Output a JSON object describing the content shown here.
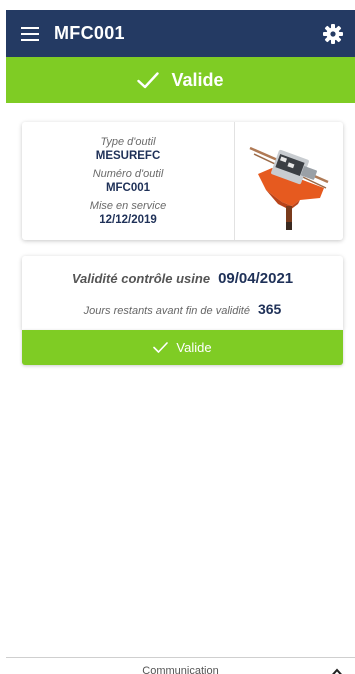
{
  "header": {
    "title": "MFC001",
    "menu_icon": "hamburger-menu-icon",
    "settings_icon": "gear-icon"
  },
  "status_banner": {
    "label": "Valide",
    "icon": "check-icon",
    "color": "#7fcc24"
  },
  "tool": {
    "type_label": "Type d'outil",
    "type_value": "MESUREFC",
    "number_label": "Numéro d'outil",
    "number_value": "MFC001",
    "service_label": "Mise en service",
    "service_value": "12/12/2019"
  },
  "validity": {
    "label": "Validité contrôle usine",
    "date": "09/04/2021",
    "remaining_label": "Jours restants avant fin de validité",
    "remaining_value": "365",
    "button_label": "Valide"
  },
  "bottom_bar": {
    "label": "Communication",
    "toggle_icon": "chevron-up-icon"
  },
  "colors": {
    "header_bg": "#243a63",
    "accent_green": "#7fcc24",
    "value_text": "#1f3158"
  }
}
